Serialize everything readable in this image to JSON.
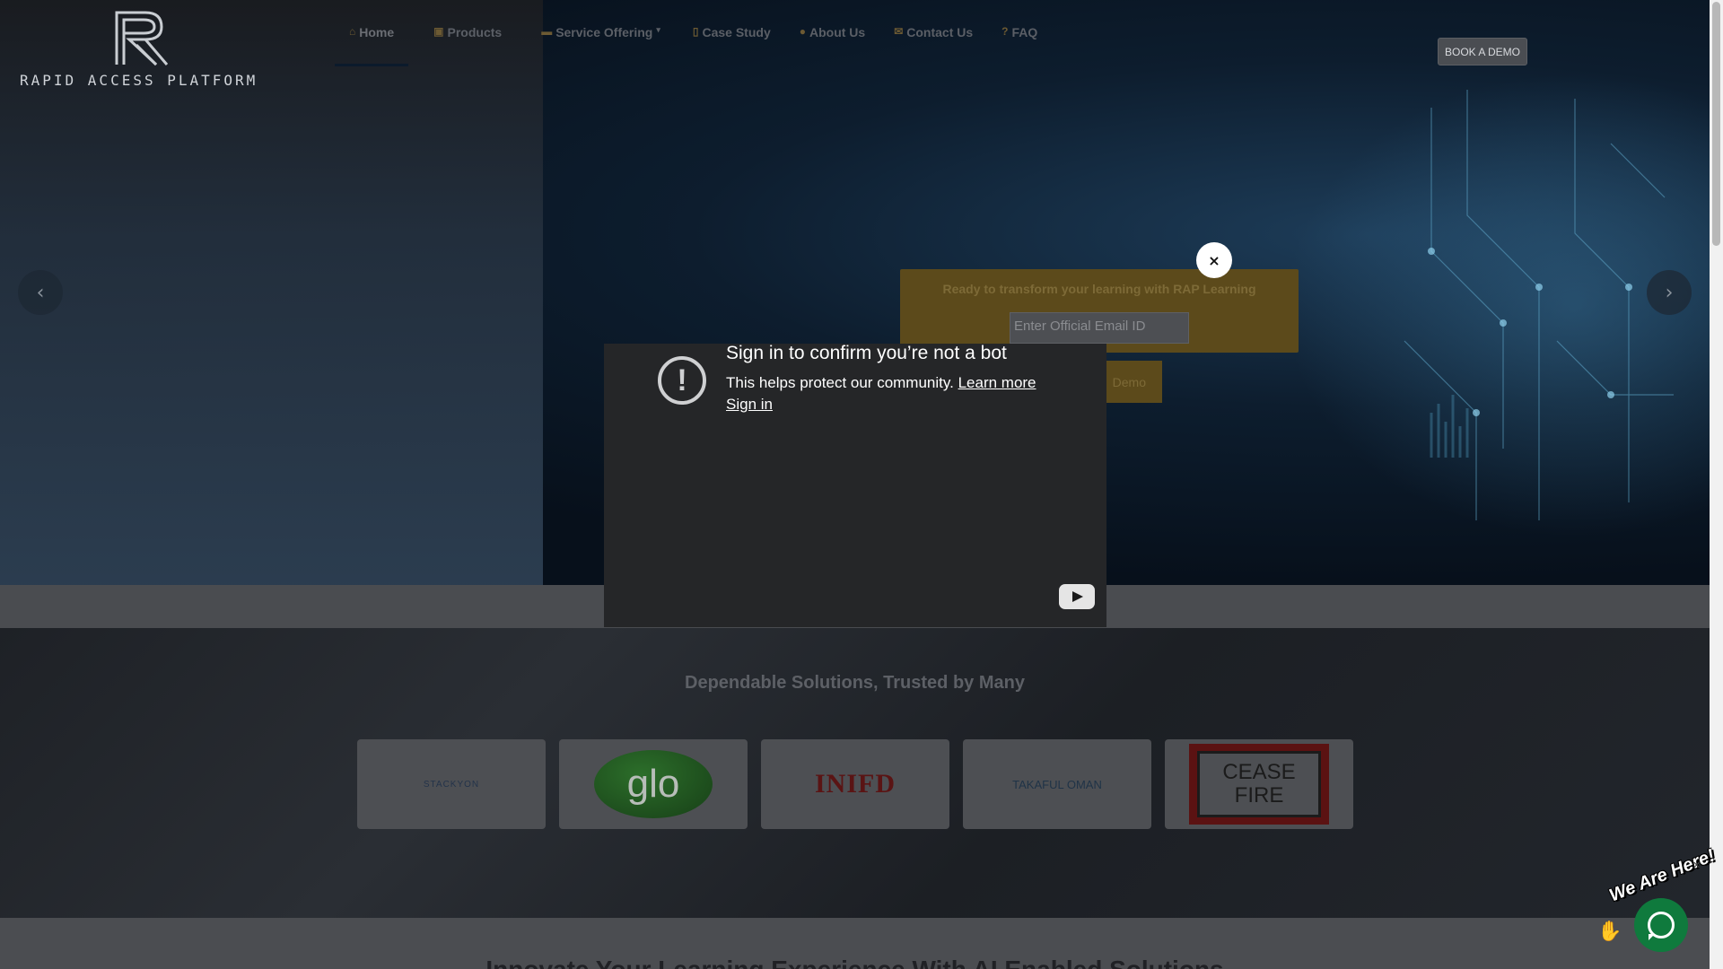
{
  "header": {
    "logo_text": "RAPID ACCESS PLATFORM",
    "nav": [
      {
        "label": "Home",
        "icon": "home-icon",
        "active": true
      },
      {
        "label": "Products",
        "icon": "cart-icon"
      },
      {
        "label": "Service Offering",
        "icon": "briefcase-icon",
        "dropdown": true
      },
      {
        "label": "Case Study",
        "icon": "book-icon"
      },
      {
        "label": "About Us",
        "icon": "info-icon"
      },
      {
        "label": "Contact Us",
        "icon": "envelope-icon"
      },
      {
        "label": "FAQ",
        "icon": "question-icon"
      }
    ],
    "book_demo": "BOOK A DEMO"
  },
  "hero": {
    "cta_text": "Ready to transform your learning with RAP Learning",
    "email_placeholder": "Enter Official Email ID",
    "demo_button": "Demo",
    "close_label": "×"
  },
  "video_modal": {
    "title": "Sign in to confirm you’re not a bot",
    "subtitle": "This helps protect our community.",
    "learn_more": "Learn more",
    "sign_in": "Sign in"
  },
  "clients": {
    "title": "Dependable Solutions, Trusted by Many",
    "logos": [
      "STACKYON",
      "glo",
      "INIFD",
      "TAKAFUL OMAN",
      "CEASE FIRE"
    ]
  },
  "bottom": {
    "heading": "Innovate Your Learning Experience With AI Enabled Solutions"
  },
  "chat": {
    "label": "We Are Here!"
  },
  "colors": {
    "accent_gold": "#5c4a1b",
    "chat_green": "#0f7a3d"
  }
}
